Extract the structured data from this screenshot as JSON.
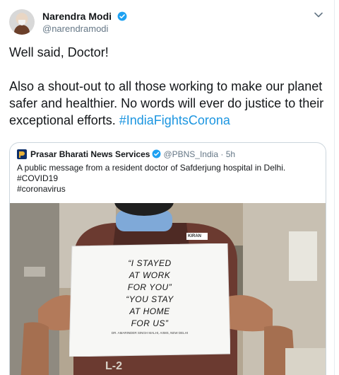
{
  "tweet": {
    "display_name": "Narendra Modi",
    "handle": "@narendramodi",
    "text_intro": "Well said, Doctor!\n\nAlso a shout-out to all those working to make our planet safer and healthier. No words will ever do justice to their exceptional efforts. ",
    "hashtag": "#IndiaFightsCorona"
  },
  "quoted_tweet": {
    "display_name": "Prasar Bharati News Services",
    "handle": "@PBNS_India",
    "separator": "·",
    "time": "5h",
    "text": "A public message from a resident doctor of Safderjung hospital in Delhi.\n#COVID19\n#coronavirus",
    "image_sign_text": "“I STAYED\nAT WORK\nFOR YOU”\n“YOU STAY\nAT HOME\nFOR US”",
    "image_sign_credit": "DR. AMARINDER SINGH MALHI, AIIMS, NEW DELHI",
    "image_vest_label": "KIRAN",
    "image_vest_number": "L-2"
  },
  "colors": {
    "accent": "#1da1f2",
    "hashtag": "#1b95e0",
    "muted": "#657786",
    "border": "#ccd6dd"
  },
  "icons": {
    "verified": "verified-badge-icon",
    "caret": "chevron-down-icon"
  }
}
